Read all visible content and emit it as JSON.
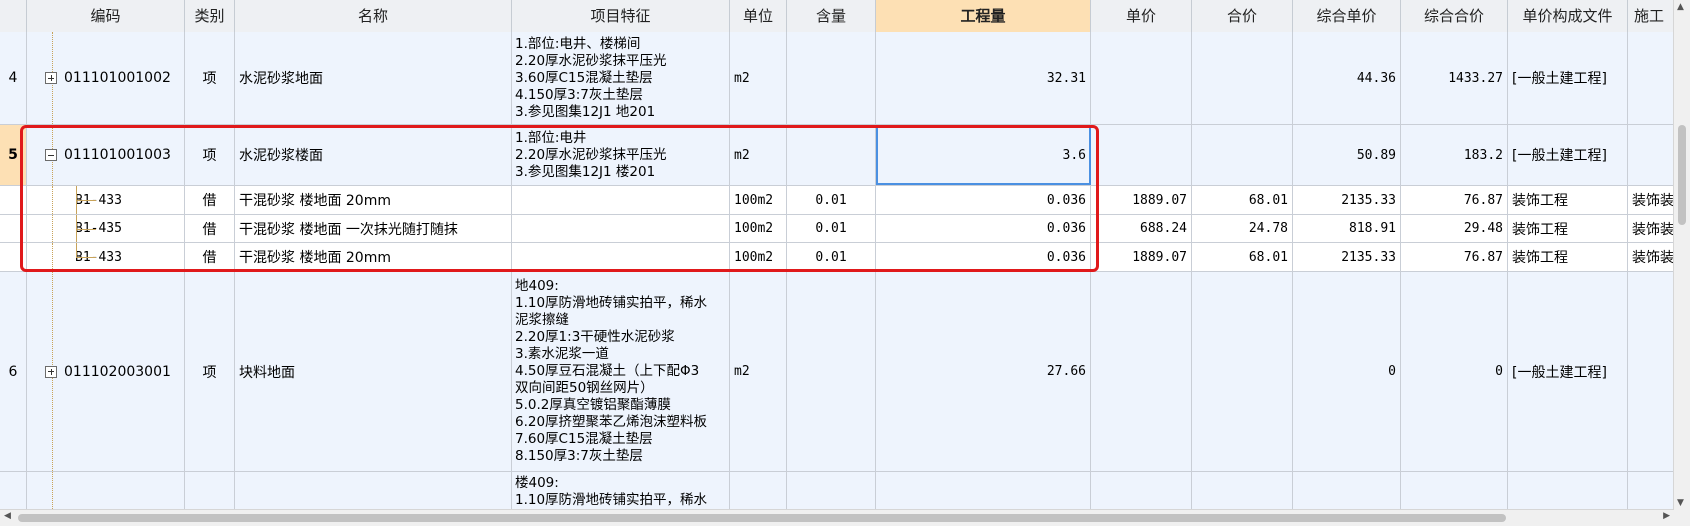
{
  "columns": {
    "code": "编码",
    "type": "类别",
    "name": "名称",
    "feature": "项目特征",
    "unit": "单位",
    "content": "含量",
    "qty": "工程量",
    "price": "单价",
    "total": "合价",
    "comp_price": "综合单价",
    "comp_total": "综合合价",
    "price_file": "单价构成文件",
    "construction": "施工"
  },
  "rows": [
    {
      "no": "4",
      "code": "011101001002",
      "type": "项",
      "name": "水泥砂浆地面",
      "feature": [
        "1.部位:电井、楼梯间",
        "2.20厚水泥砂浆抹平压光",
        "3.60厚C15混凝土垫层",
        "4.150厚3:7灰土垫层",
        "3.参见图集12J1 地201"
      ],
      "unit": "m2",
      "content": "",
      "qty": "32.31",
      "price": "",
      "total": "",
      "comp_price": "44.36",
      "comp_total": "1433.27",
      "price_file": "[一般土建工程]",
      "construction": ""
    },
    {
      "no": "5",
      "code": "011101001003",
      "type": "项",
      "name": "水泥砂浆楼面",
      "feature": [
        "1.部位:电井",
        "2.20厚水泥砂浆抹平压光",
        "3.参见图集12J1 楼201"
      ],
      "unit": "m2",
      "content": "",
      "qty": "3.6",
      "price": "",
      "total": "",
      "comp_price": "50.89",
      "comp_total": "183.2",
      "price_file": "[一般土建工程]",
      "construction": ""
    },
    {
      "no": "",
      "code": "B1-433",
      "type": "借",
      "name": "干混砂浆 楼地面 20mm",
      "feature": [],
      "unit": "100m2",
      "content": "0.01",
      "qty": "0.036",
      "price": "1889.07",
      "total": "68.01",
      "comp_price": "2135.33",
      "comp_total": "76.87",
      "price_file": "装饰工程",
      "construction": "装饰装"
    },
    {
      "no": "",
      "code": "B1-435",
      "type": "借",
      "name": "干混砂浆 楼地面 一次抹光随打随抹",
      "feature": [],
      "unit": "100m2",
      "content": "0.01",
      "qty": "0.036",
      "price": "688.24",
      "total": "24.78",
      "comp_price": "818.91",
      "comp_total": "29.48",
      "price_file": "装饰工程",
      "construction": "装饰装"
    },
    {
      "no": "",
      "code": "B1-433",
      "type": "借",
      "name": "干混砂浆 楼地面 20mm",
      "feature": [],
      "unit": "100m2",
      "content": "0.01",
      "qty": "0.036",
      "price": "1889.07",
      "total": "68.01",
      "comp_price": "2135.33",
      "comp_total": "76.87",
      "price_file": "装饰工程",
      "construction": "装饰装"
    },
    {
      "no": "6",
      "code": "011102003001",
      "type": "项",
      "name": "块料地面",
      "feature": [
        "地409:",
        "1.10厚防滑地砖铺实拍平，稀水",
        "泥浆擦缝",
        "2.20厚1:3干硬性水泥砂浆",
        "3.素水泥浆一道",
        "4.50厚豆石混凝土（上下配Φ3",
        "双向间距50钢丝网片）",
        "5.0.2厚真空镀铝聚酯薄膜",
        "6.20厚挤塑聚苯乙烯泡沫塑料板",
        "7.60厚C15混凝土垫层",
        "8.150厚3:7灰土垫层"
      ],
      "unit": "m2",
      "content": "",
      "qty": "27.66",
      "price": "",
      "total": "",
      "comp_price": "0",
      "comp_total": "0",
      "price_file": "[一般土建工程]",
      "construction": ""
    },
    {
      "no": "",
      "code": "",
      "type": "",
      "name": "",
      "feature": [
        "楼409:",
        "1.10厚防滑地砖铺实拍平，稀水"
      ],
      "unit": "",
      "content": "",
      "qty": "",
      "price": "",
      "total": "",
      "comp_price": "",
      "comp_total": "",
      "price_file": "",
      "construction": ""
    }
  ]
}
